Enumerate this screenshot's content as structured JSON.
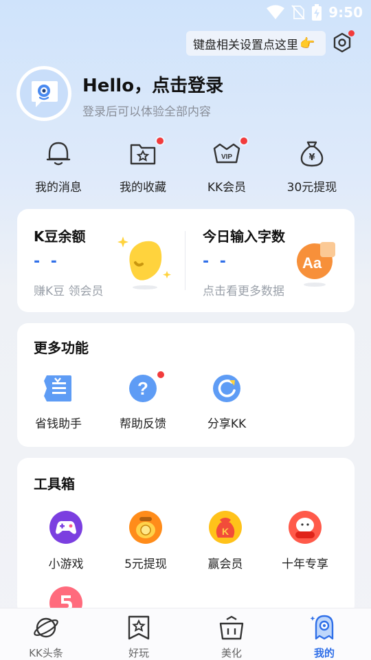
{
  "status_bar": {
    "time": "9:50"
  },
  "header": {
    "keyboard_tip": "键盘相关设置点这里",
    "keyboard_tip_emoji": "👉"
  },
  "profile": {
    "title": "Hello，点击登录",
    "subtitle": "登录后可以体验全部内容"
  },
  "quick_actions": [
    {
      "label": "我的消息",
      "icon": "bell-icon",
      "badge": false
    },
    {
      "label": "我的收藏",
      "icon": "favorites-folder-icon",
      "badge": true
    },
    {
      "label": "KK会员",
      "icon": "vip-crown-icon",
      "badge": true
    },
    {
      "label": "30元提现",
      "icon": "money-bag-icon",
      "badge": false
    }
  ],
  "stats": {
    "beans": {
      "title": "K豆余额",
      "value": "- -",
      "sub": "赚K豆 领会员"
    },
    "typing": {
      "title": "今日输入字数",
      "value": "- -",
      "sub": "点击看更多数据"
    }
  },
  "more_features": {
    "title": "更多功能",
    "items": [
      {
        "label": "省钱助手",
        "icon": "coupon-icon",
        "badge": false
      },
      {
        "label": "帮助反馈",
        "icon": "help-icon",
        "badge": true
      },
      {
        "label": "分享KK",
        "icon": "share-icon",
        "badge": false
      }
    ]
  },
  "toolbox": {
    "title": "工具箱",
    "items": [
      {
        "label": "小游戏",
        "icon": "gamepad-icon"
      },
      {
        "label": "5元提现",
        "icon": "coin-pot-icon"
      },
      {
        "label": "赢会员",
        "icon": "lucky-bag-icon"
      },
      {
        "label": "十年专享",
        "icon": "free-badge-icon"
      }
    ]
  },
  "bottom_nav": [
    {
      "label": "KK头条",
      "icon": "planet-icon",
      "active": false
    },
    {
      "label": "好玩",
      "icon": "bookmark-star-icon",
      "active": false
    },
    {
      "label": "美化",
      "icon": "basket-icon",
      "active": false
    },
    {
      "label": "我的",
      "icon": "ghost-icon",
      "active": true
    }
  ],
  "colors": {
    "accent": "#2f6fe8",
    "badge": "#f23b3b",
    "background": "#f2f3f7"
  }
}
